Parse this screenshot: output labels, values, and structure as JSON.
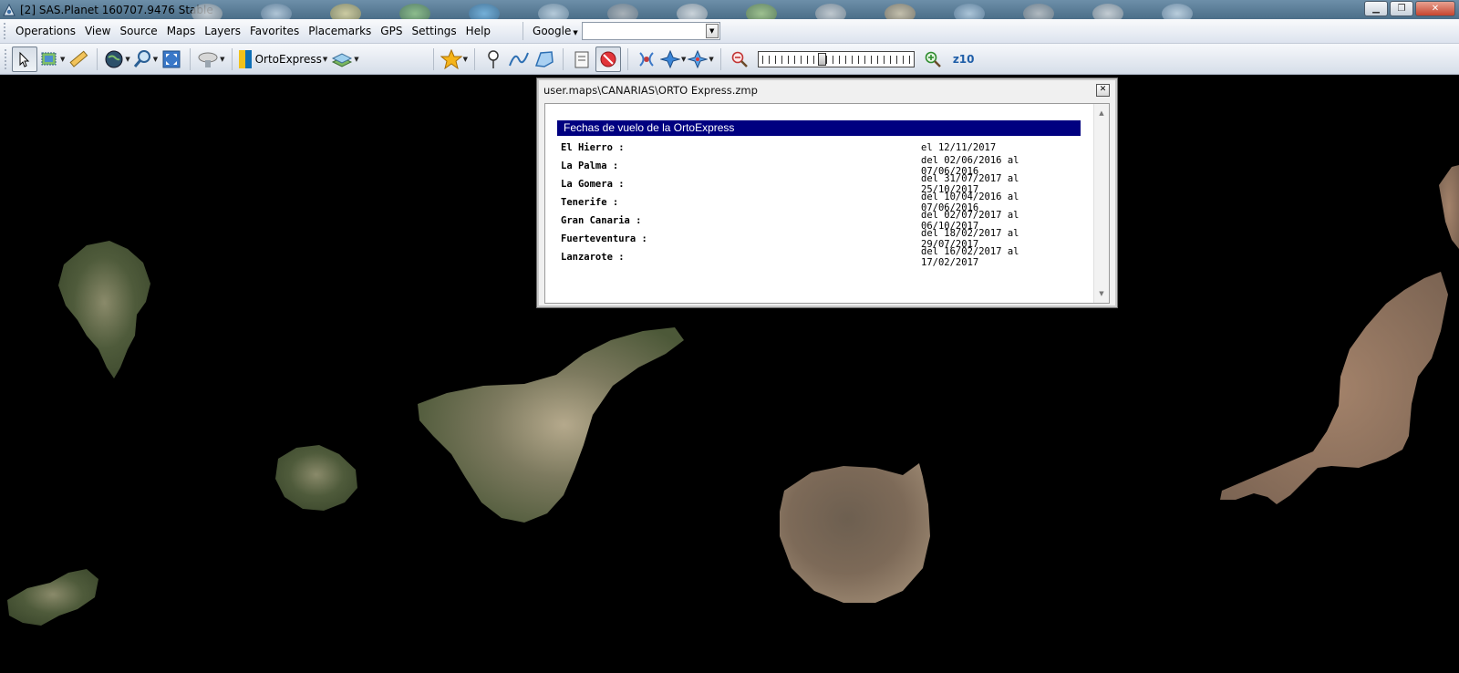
{
  "window": {
    "title": "[2] SAS.Planet 160707.9476 Stable"
  },
  "menu": {
    "items": [
      "Operations",
      "View",
      "Source",
      "Maps",
      "Layers",
      "Favorites",
      "Placemarks",
      "GPS",
      "Settings",
      "Help"
    ]
  },
  "search": {
    "provider": "Google",
    "value": ""
  },
  "toolbar": {
    "map_name": "OrtoExpress",
    "zoom_label": "z10",
    "zoom_level": 10,
    "zoom_max": 24,
    "icons": [
      "pointer-icon",
      "select-area-icon",
      "ruler-icon",
      "globe-icon",
      "zoom-tool-icon",
      "fullscreen-icon",
      "satellite-dish-icon",
      "map-source-icon",
      "layers-icon",
      "favorite-star-icon",
      "placemark-pin-icon",
      "path-icon",
      "polygon-icon",
      "placemark-list-icon",
      "stop-icon",
      "gps-satellite-icon",
      "gps-track-icon",
      "gps-navigation-icon",
      "zoom-out-icon",
      "zoom-in-icon"
    ]
  },
  "info_window": {
    "title": "user.maps\\CANARIAS\\ORTO Express.zmp",
    "header": "Fechas de vuelo de la OrtoExpress",
    "rows": [
      {
        "island": "El Hierro :",
        "dates": "el 12/11/2017"
      },
      {
        "island": "La Palma :",
        "dates": "del 02/06/2016 al 07/06/2016"
      },
      {
        "island": "La Gomera :",
        "dates": "del 31/07/2017 al 25/10/2017"
      },
      {
        "island": "Tenerife :",
        "dates": "del 10/04/2016 al 07/06/2016"
      },
      {
        "island": "Gran Canaria :",
        "dates": "del 02/07/2017 al 06/10/2017"
      },
      {
        "island": "Fuerteventura :",
        "dates": "del 18/02/2017 al 29/07/2017"
      },
      {
        "island": "Lanzarote :",
        "dates": "del 16/02/2017 al 17/02/2017"
      }
    ]
  },
  "colors": {
    "map_background": "#000000",
    "info_header": "#000080",
    "zoom_label": "#1f5ea8"
  }
}
